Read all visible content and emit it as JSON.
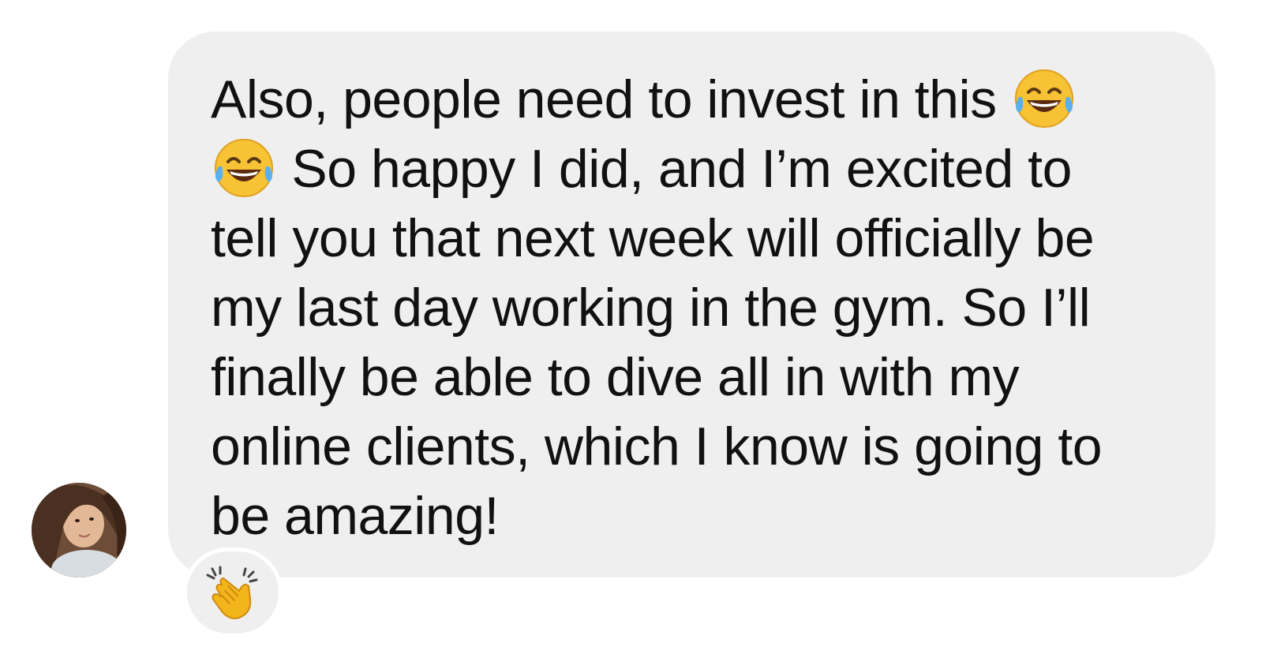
{
  "message": {
    "line_1": "Also, people need to invest in this ",
    "line_2": " So happy I did, and I’m excited to",
    "line_3": "tell you that next week will officially be",
    "line_4": "my last day working in the gym. So I’ll",
    "line_5": "finally be able to dive all in with my",
    "line_6": "online clients, which I know is going to",
    "line_7": "be amazing!",
    "emoji_1": "face-with-tears-of-joy-icon",
    "emoji_2": "face-with-tears-of-joy-icon"
  },
  "reaction": {
    "emoji": "clapping-hands-icon"
  },
  "avatar": {
    "icon": "user-photo-avatar"
  },
  "colors": {
    "bubble_bg": "#efefef",
    "text": "#111111",
    "background": "#ffffff"
  }
}
